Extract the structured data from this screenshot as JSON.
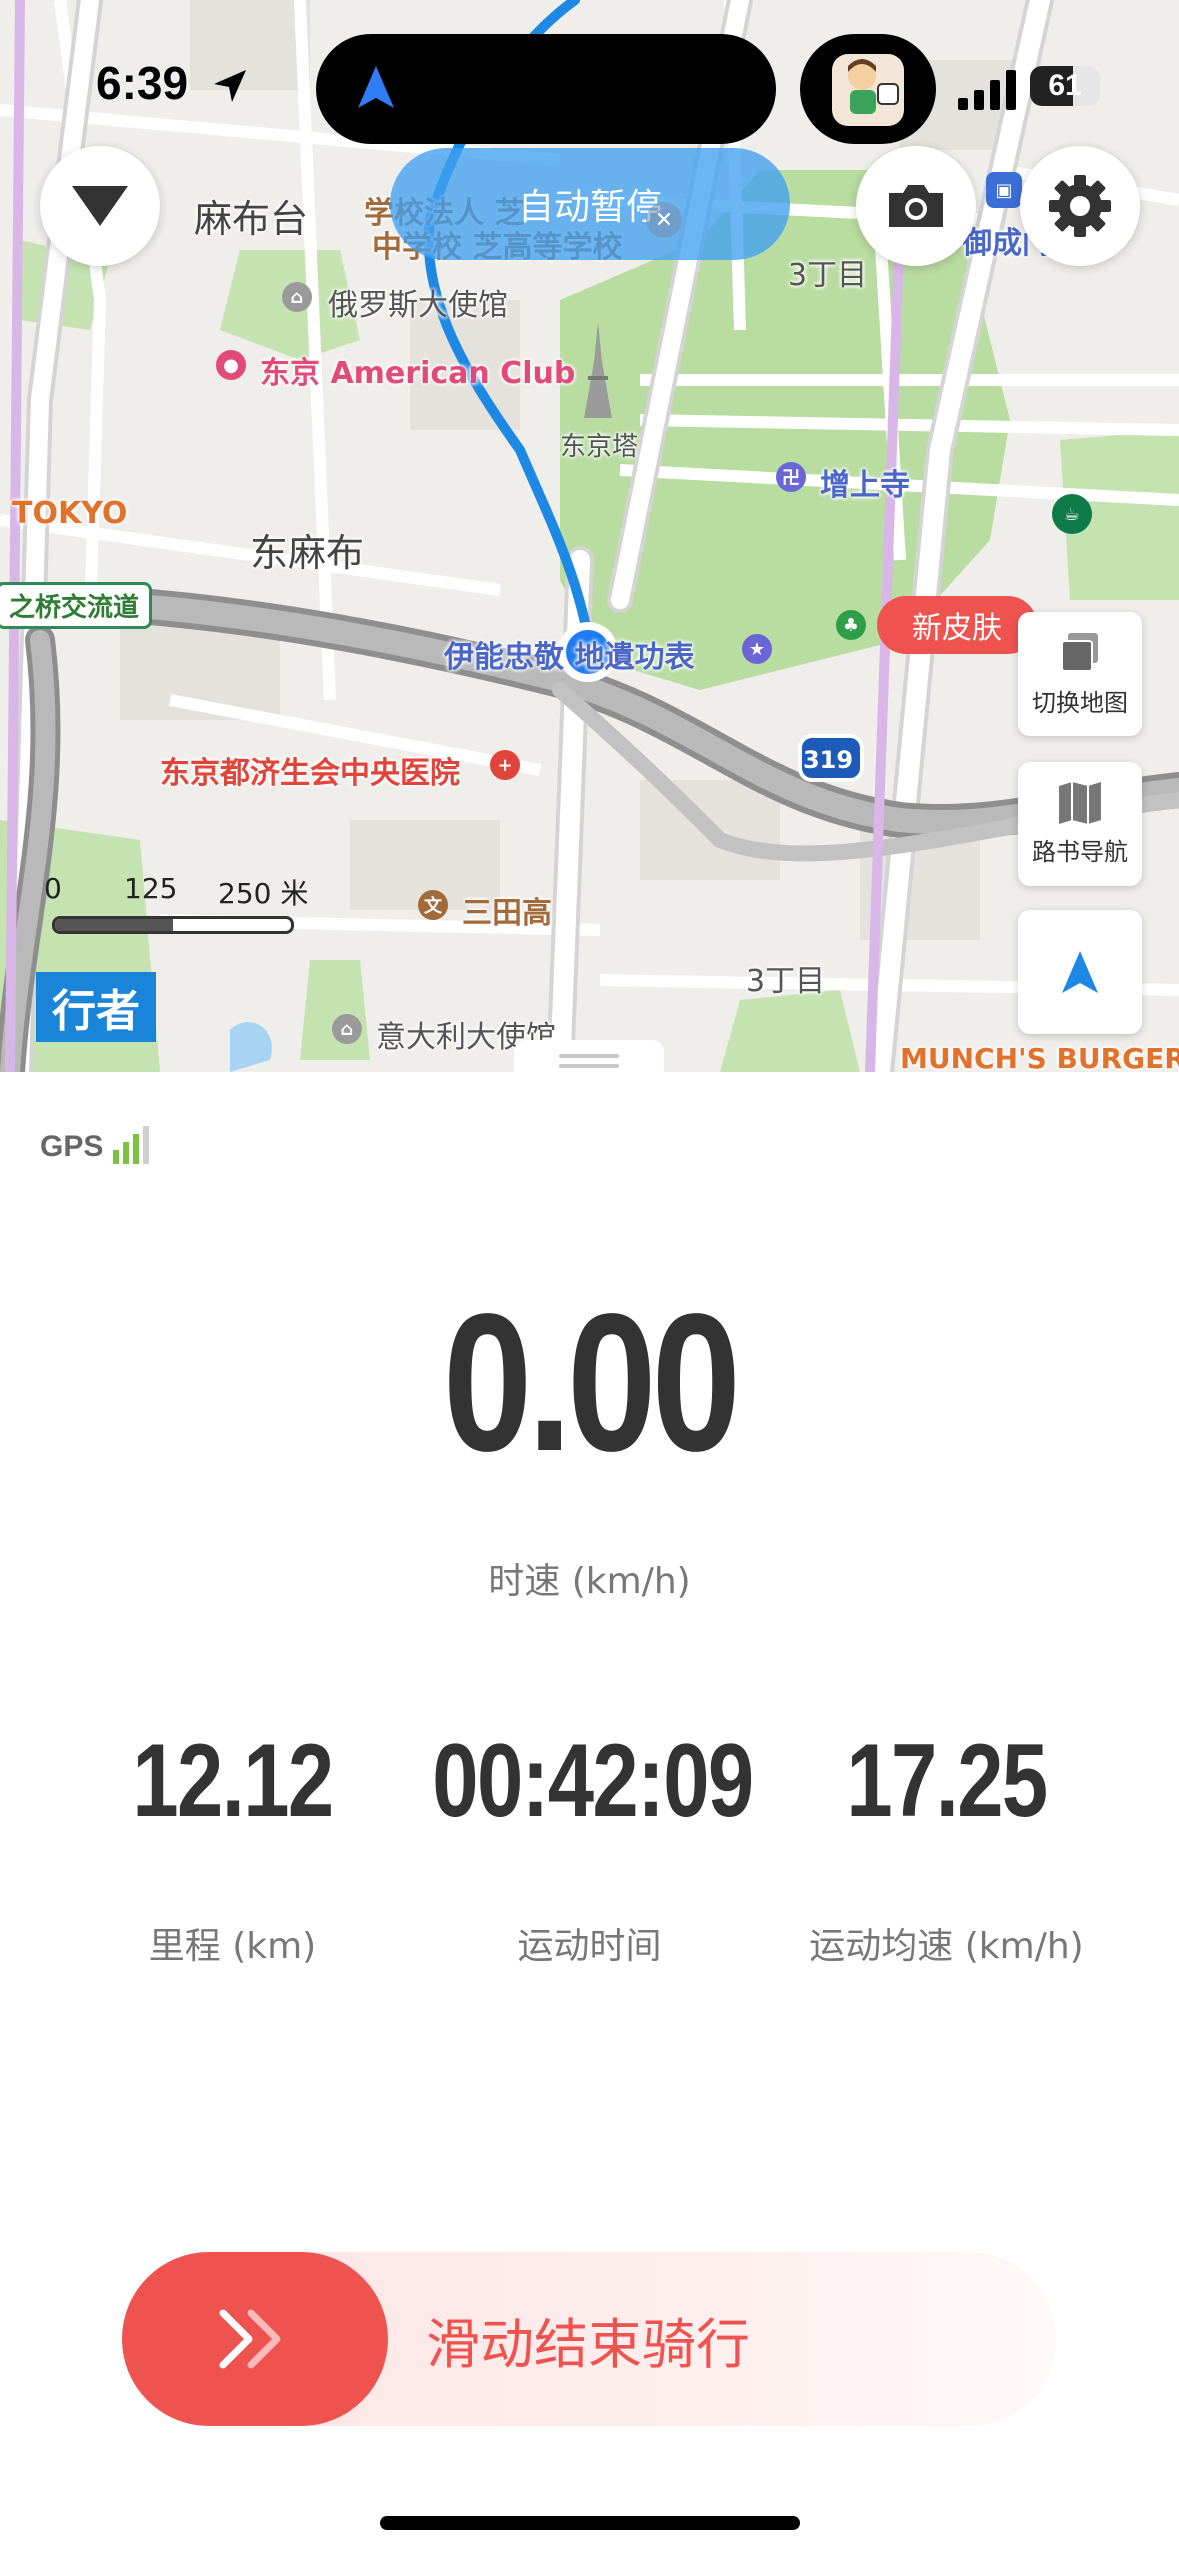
{
  "status_bar": {
    "time": "6:39",
    "battery": "61",
    "battery_level": 0.61
  },
  "map": {
    "labels": {
      "azabudai": "麻布台",
      "school_line1": "学校法人 芝",
      "school_line2": "中学校 芝高等学校",
      "russia_embassy": "俄罗斯大使馆",
      "american_club": "东京 American Club",
      "tokyo_tower": "东京塔",
      "zojoji": "增上寺",
      "chome3_top": "3丁目",
      "tokyo_left": "TOKYO",
      "higashi_azabu": "东麻布",
      "junction": "之桥交流道",
      "ino_monument": "伊能忠敬 地遺功表",
      "hospital": "东京都济生会中央医院",
      "route": "319",
      "mita_high": "三田高",
      "chome3_bottom": "3丁目",
      "italy_embassy": "意大利大使馆",
      "munch": "MUNCH'S BURGER",
      "onarimon": "御成门"
    },
    "scale": {
      "n0": "0",
      "n1": "125",
      "n2": "250 米"
    },
    "walker_badge": "行者"
  },
  "controls": {
    "auto_pause": "自动暂停",
    "new_skin": "新皮肤",
    "switch_map": "切换地图",
    "route_nav": "路书导航"
  },
  "stats": {
    "gps_label": "GPS",
    "speed_value": "0.00",
    "speed_label": "时速 (km/h)",
    "distance_value": "12.12",
    "distance_label": "里程 (km)",
    "time_value": "00:42:09",
    "time_label": "运动时间",
    "avg_value": "17.25",
    "avg_label": "运动均速 (km/h)"
  },
  "slider": {
    "label": "滑动结束骑行"
  },
  "colors": {
    "accent": "#ef5350",
    "route": "#1e88e5",
    "gps_signal": "#7cc242"
  }
}
